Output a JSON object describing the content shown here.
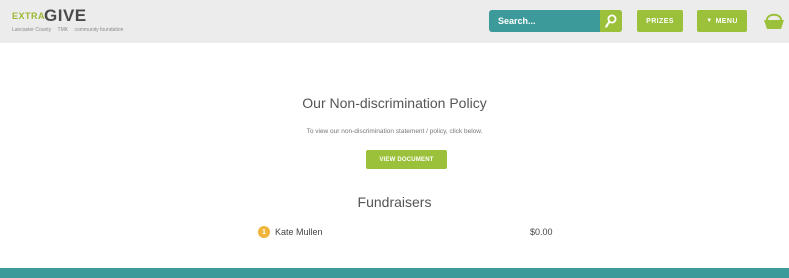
{
  "header": {
    "logo_extra": "EXTRA",
    "logo_give": "GIVE",
    "logo_sponsors": [
      "Lancaster County",
      "TMK",
      "community foundation"
    ],
    "search_placeholder": "Search...",
    "prizes_label": "PRIZES",
    "menu_label": "MENU",
    "icons": {
      "search": "search-icon",
      "menu": "triangle-down-icon",
      "basket": "basket-icon"
    }
  },
  "policy": {
    "title": "Our Non-discrimination Policy",
    "text": "To view our non-discrimination statement / policy, click below.",
    "button_label": "VIEW DOCUMENT"
  },
  "fundraisers": {
    "title": "Fundraisers",
    "items": [
      {
        "rank": "1",
        "name": "Kate Mullen",
        "amount": "$0.00"
      }
    ]
  },
  "colors": {
    "teal": "#3d9a9a",
    "green": "#9bc03a",
    "rank_badge": "#f0b43a",
    "header_bg": "#ececec"
  }
}
